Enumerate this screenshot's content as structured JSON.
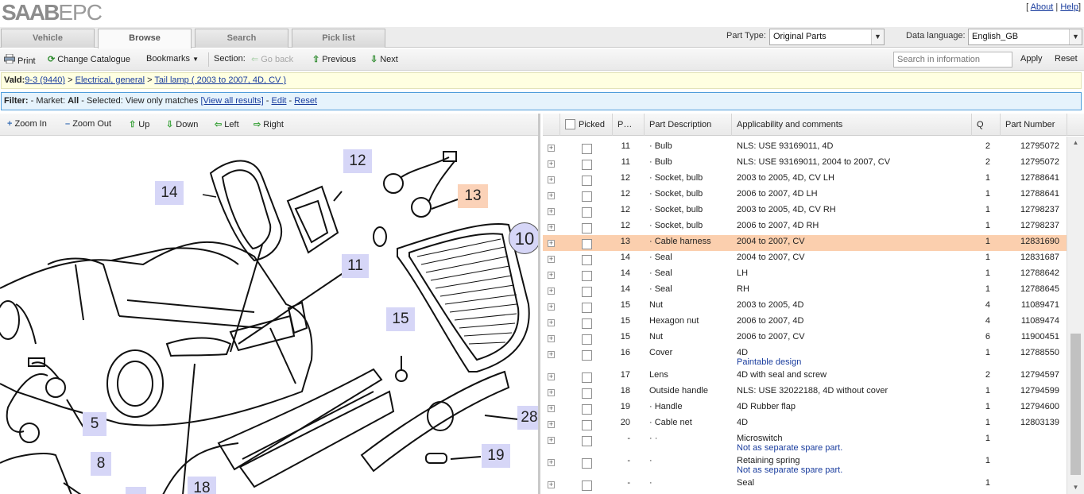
{
  "app": {
    "logo_brand": "SAAB",
    "logo_suffix": "EPC",
    "about": "About",
    "help": "Help"
  },
  "tabs": [
    "Vehicle",
    "Browse",
    "Search",
    "Pick list"
  ],
  "part_type": {
    "label": "Part Type:",
    "value": "Original Parts"
  },
  "data_language": {
    "label": "Data language:",
    "value": "English_GB"
  },
  "toolbar": {
    "print": "Print",
    "change_catalogue": "Change Catalogue",
    "bookmarks": "Bookmarks",
    "section": "Section:",
    "go_back": "Go back",
    "previous": "Previous",
    "next": "Next",
    "search_placeholder": "Search in information",
    "apply": "Apply",
    "reset": "Reset"
  },
  "path": {
    "label": "Vald:",
    "items": [
      "9-3 (9440)",
      "Electrical, general",
      "Tail lamp ( 2003 to 2007, 4D, CV )"
    ]
  },
  "filter": {
    "label": "Filter:",
    "market_label": "- Market:",
    "market_value": "All",
    "selected_label": "- Selected:",
    "selected_value": "View only matches",
    "view_all": "[View all results]",
    "edit": "Edit",
    "reset": "Reset"
  },
  "zoombar": {
    "zoom_in": "Zoom In",
    "zoom_out": "Zoom Out",
    "up": "Up",
    "down": "Down",
    "left": "Left",
    "right": "Right"
  },
  "callouts": {
    "c14": "14",
    "c12": "12",
    "c13": "13",
    "c10": "10",
    "c11": "11",
    "c15": "15",
    "c5": "5",
    "c8": "8",
    "c28": "28",
    "c19": "19",
    "c18": "18"
  },
  "table": {
    "headers": {
      "picked": "Picked",
      "pos": "P…",
      "description": "Part Description",
      "applicability": "Applicability and comments",
      "qty": "Q",
      "part_number": "Part Number"
    },
    "rows": [
      {
        "pos": "11",
        "desc": "· Bulb",
        "appl": "NLS: USE 93169011, 4D",
        "sub": "",
        "qty": "2",
        "pn": "12795072"
      },
      {
        "pos": "11",
        "desc": "· Bulb",
        "appl": "NLS: USE 93169011, 2004 to 2007, CV",
        "sub": "",
        "qty": "2",
        "pn": "12795072"
      },
      {
        "pos": "12",
        "desc": "· Socket, bulb",
        "appl": "2003 to 2005, 4D, CV LH",
        "sub": "",
        "qty": "1",
        "pn": "12788641"
      },
      {
        "pos": "12",
        "desc": "· Socket, bulb",
        "appl": "2006 to 2007, 4D LH",
        "sub": "",
        "qty": "1",
        "pn": "12788641"
      },
      {
        "pos": "12",
        "desc": "· Socket, bulb",
        "appl": "2003 to 2005, 4D, CV RH",
        "sub": "",
        "qty": "1",
        "pn": "12798237"
      },
      {
        "pos": "12",
        "desc": "· Socket, bulb",
        "appl": "2006 to 2007, 4D RH",
        "sub": "",
        "qty": "1",
        "pn": "12798237"
      },
      {
        "pos": "13",
        "desc": "· Cable harness",
        "appl": "2004 to 2007, CV",
        "sub": "",
        "qty": "1",
        "pn": "12831690"
      },
      {
        "pos": "14",
        "desc": "· Seal",
        "appl": "2004 to 2007, CV",
        "sub": "",
        "qty": "1",
        "pn": "12831687"
      },
      {
        "pos": "14",
        "desc": "· Seal",
        "appl": "LH",
        "sub": "",
        "qty": "1",
        "pn": "12788642"
      },
      {
        "pos": "14",
        "desc": "· Seal",
        "appl": "RH",
        "sub": "",
        "qty": "1",
        "pn": "12788645"
      },
      {
        "pos": "15",
        "desc": "Nut",
        "appl": "2003 to 2005, 4D",
        "sub": "",
        "qty": "4",
        "pn": "11089471"
      },
      {
        "pos": "15",
        "desc": "Hexagon nut",
        "appl": "2006 to 2007, 4D",
        "sub": "",
        "qty": "4",
        "pn": "11089474"
      },
      {
        "pos": "15",
        "desc": "Nut",
        "appl": "2006 to 2007, CV",
        "sub": "",
        "qty": "6",
        "pn": "11900451"
      },
      {
        "pos": "16",
        "desc": "Cover",
        "appl": "4D",
        "sub": "Paintable design",
        "qty": "1",
        "pn": "12788550"
      },
      {
        "pos": "17",
        "desc": "Lens",
        "appl": "4D with seal and screw",
        "sub": "",
        "qty": "2",
        "pn": "12794597"
      },
      {
        "pos": "18",
        "desc": "Outside handle",
        "appl": "NLS: USE 32022188, 4D without cover",
        "sub": "",
        "qty": "1",
        "pn": "12794599"
      },
      {
        "pos": "19",
        "desc": "· Handle",
        "appl": "4D Rubber flap",
        "sub": "",
        "qty": "1",
        "pn": "12794600"
      },
      {
        "pos": "20",
        "desc": "· Cable net",
        "appl": "4D",
        "sub": "",
        "qty": "1",
        "pn": "12803139"
      },
      {
        "pos": "-",
        "desc": "· ·",
        "appl": "Microswitch",
        "sub": "Not as separate spare part.",
        "qty": "1",
        "pn": ""
      },
      {
        "pos": "-",
        "desc": "·",
        "appl": "Retaining spring",
        "sub": "Not as separate spare part.",
        "qty": "1",
        "pn": ""
      },
      {
        "pos": "-",
        "desc": "·",
        "appl": "Seal",
        "sub": "",
        "qty": "1",
        "pn": ""
      }
    ],
    "highlight_row_index": 6,
    "highlight_color": "#fbcfae"
  },
  "colors": {
    "link": "#1a3d9e",
    "callout_bg": "#d6d6f7",
    "callout_highlight_bg": "#fbd2b8",
    "path_bg": "#ffffe1",
    "filter_bg": "#e6f3fc"
  }
}
